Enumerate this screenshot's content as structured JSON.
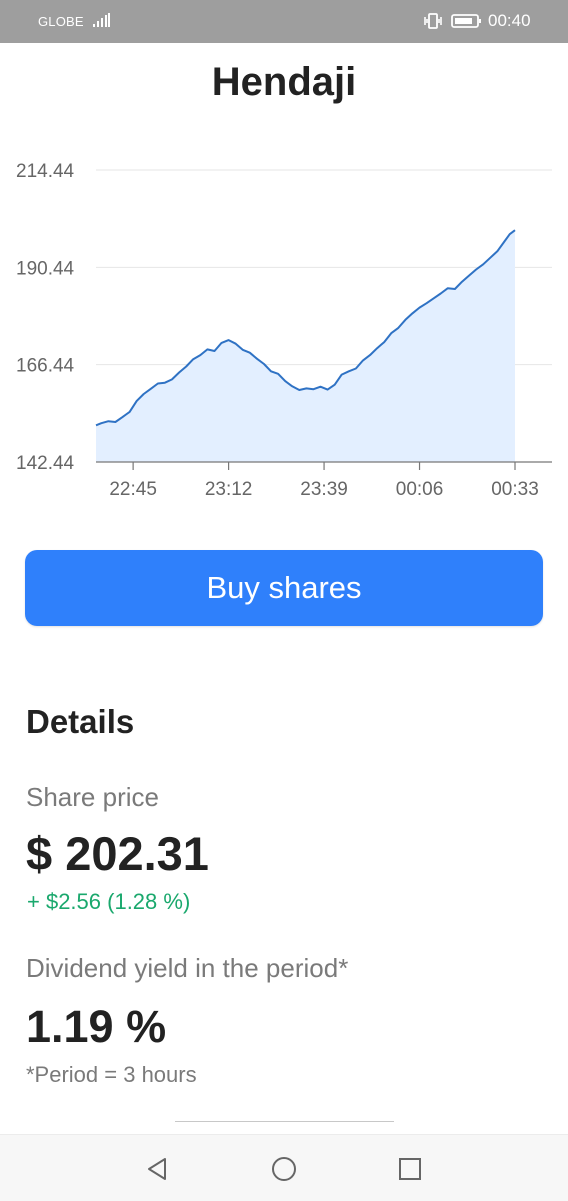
{
  "status_bar": {
    "carrier": "GLOBE",
    "time": "00:40",
    "icons": [
      "signal-icon",
      "vibrate-icon",
      "battery-icon"
    ]
  },
  "header": {
    "title": "Hendaji"
  },
  "chart_data": {
    "type": "area",
    "title": "",
    "xlabel": "",
    "ylabel": "",
    "ylim": [
      142.44,
      214.44
    ],
    "y_ticks": [
      "214.44",
      "190.44",
      "166.44",
      "142.44"
    ],
    "x_ticks": [
      "22:45",
      "23:12",
      "23:39",
      "00:06",
      "00:33"
    ],
    "x_tick_positions_minutes": [
      0,
      27,
      54,
      81,
      108
    ],
    "x_range_minutes": [
      -10.5,
      108
    ],
    "grid": true,
    "series": [
      {
        "color": "#2f72c4",
        "fill": "#e3efff",
        "points": [
          [
            -10.5,
            151.5
          ],
          [
            -9,
            152.0
          ],
          [
            -7,
            152.5
          ],
          [
            -5,
            152.3
          ],
          [
            -3,
            153.5
          ],
          [
            -1,
            154.8
          ],
          [
            1,
            157.5
          ],
          [
            3,
            159.2
          ],
          [
            5,
            160.5
          ],
          [
            7,
            161.8
          ],
          [
            9,
            162.0
          ],
          [
            11,
            162.8
          ],
          [
            13,
            164.5
          ],
          [
            15,
            166.0
          ],
          [
            17,
            167.8
          ],
          [
            19,
            168.8
          ],
          [
            21,
            170.2
          ],
          [
            23,
            169.8
          ],
          [
            25,
            171.8
          ],
          [
            27,
            172.5
          ],
          [
            29,
            171.6
          ],
          [
            31,
            170.1
          ],
          [
            33,
            169.4
          ],
          [
            35,
            167.9
          ],
          [
            37,
            166.6
          ],
          [
            39,
            164.8
          ],
          [
            41,
            164.2
          ],
          [
            43,
            162.4
          ],
          [
            45,
            161.1
          ],
          [
            47,
            160.2
          ],
          [
            49,
            160.6
          ],
          [
            51,
            160.4
          ],
          [
            53,
            161.0
          ],
          [
            55,
            160.3
          ],
          [
            57,
            161.5
          ],
          [
            59,
            164.0
          ],
          [
            61,
            164.8
          ],
          [
            63,
            165.5
          ],
          [
            65,
            167.5
          ],
          [
            67,
            168.8
          ],
          [
            69,
            170.5
          ],
          [
            71,
            172.0
          ],
          [
            73,
            174.2
          ],
          [
            75,
            175.5
          ],
          [
            77,
            177.5
          ],
          [
            79,
            179.1
          ],
          [
            81,
            180.5
          ],
          [
            83,
            181.6
          ],
          [
            85,
            182.8
          ],
          [
            87,
            184.0
          ],
          [
            89,
            185.3
          ],
          [
            91,
            185.1
          ],
          [
            93,
            186.9
          ],
          [
            95,
            188.4
          ],
          [
            97,
            189.9
          ],
          [
            99,
            191.2
          ],
          [
            101,
            192.8
          ],
          [
            103,
            194.4
          ],
          [
            105,
            196.8
          ],
          [
            106.5,
            198.6
          ],
          [
            108,
            199.6
          ]
        ]
      }
    ]
  },
  "actions": {
    "buy_label": "Buy shares"
  },
  "details": {
    "heading": "Details",
    "share_price_label": "Share price",
    "share_price_value": "$ 202.31",
    "change": "+ $2.56 (1.28 %)",
    "dividend_label": "Dividend yield in the period*",
    "dividend_value": "1.19 %",
    "footnote": "*Period = 3 hours"
  },
  "nav_bar": {
    "icons": [
      "back-icon",
      "home-icon",
      "recent-apps-icon"
    ]
  },
  "colors": {
    "accent": "#2f80fb",
    "positive": "#1aa86d",
    "line": "#2f72c4",
    "area": "#e3efff",
    "status_bar": "#9e9e9e"
  }
}
